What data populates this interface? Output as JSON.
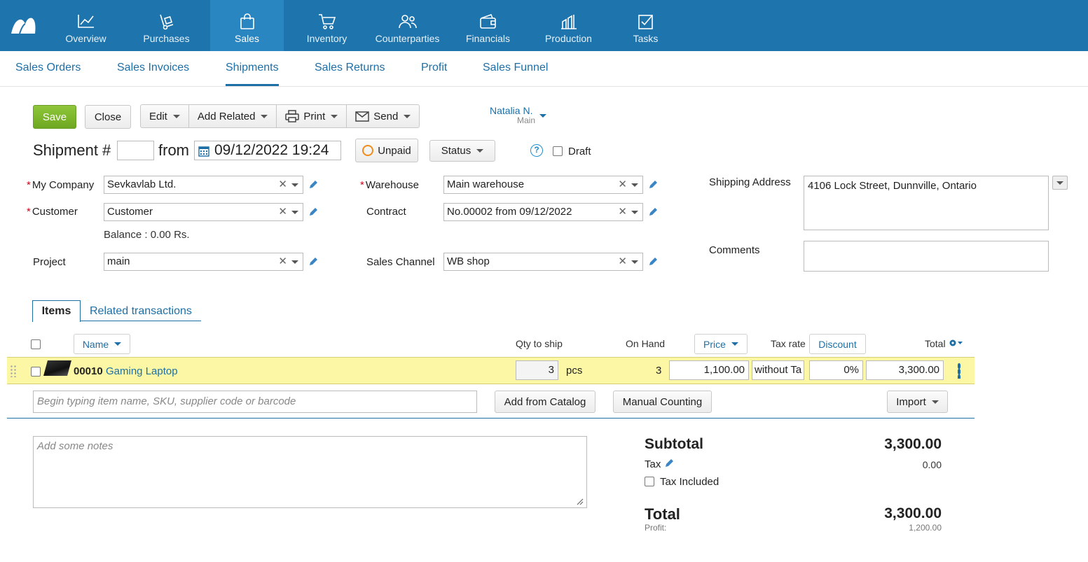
{
  "nav": {
    "items": [
      {
        "label": "Overview",
        "icon": "chart-line-icon"
      },
      {
        "label": "Purchases",
        "icon": "hand-truck-icon"
      },
      {
        "label": "Sales",
        "icon": "shopping-bag-icon"
      },
      {
        "label": "Inventory",
        "icon": "cart-icon"
      },
      {
        "label": "Counterparties",
        "icon": "people-icon"
      },
      {
        "label": "Financials",
        "icon": "wallet-icon"
      },
      {
        "label": "Production",
        "icon": "factory-icon"
      },
      {
        "label": "Tasks",
        "icon": "checkbox-icon"
      }
    ],
    "active": "Sales"
  },
  "subnav": {
    "items": [
      "Sales Orders",
      "Sales Invoices",
      "Shipments",
      "Sales Returns",
      "Profit",
      "Sales Funnel"
    ],
    "active": "Shipments"
  },
  "toolbar": {
    "save": "Save",
    "close": "Close",
    "edit": "Edit",
    "add_related": "Add Related",
    "print": "Print",
    "send": "Send",
    "user_name": "Natalia N.",
    "user_sub": "Main"
  },
  "doc": {
    "title": "Shipment #",
    "number": "",
    "from": "from",
    "date": "09/12/2022 19:24",
    "payment": "Unpaid",
    "status": "Status",
    "help": "?",
    "draft": "Draft"
  },
  "form": {
    "my_company_label": "My Company",
    "my_company": "Sevkavlab Ltd.",
    "customer_label": "Customer",
    "customer": "Customer",
    "balance": "Balance : 0.00 Rs.",
    "project_label": "Project",
    "project": "main",
    "warehouse_label": "Warehouse",
    "warehouse": "Main warehouse",
    "contract_label": "Contract",
    "contract": "No.00002 from 09/12/2022",
    "channel_label": "Sales Channel",
    "channel": "WB shop",
    "shipping_label": "Shipping Address",
    "shipping": "4106 Lock Street, Dunnville, Ontario",
    "comments_label": "Comments",
    "comments": ""
  },
  "tabs": {
    "items": "Items",
    "related": "Related transactions"
  },
  "table": {
    "columns": {
      "name": "Name",
      "qty": "Qty to ship",
      "on_hand": "On Hand",
      "price": "Price",
      "tax_rate": "Tax rate",
      "discount": "Discount",
      "total": "Total"
    },
    "rows": [
      {
        "code": "00010",
        "name": "Gaming Laptop",
        "qty": "3",
        "unit": "pcs",
        "on_hand": "3",
        "price": "1,100.00",
        "tax_rate": "without Ta",
        "discount": "0%",
        "total": "3,300.00"
      }
    ],
    "search_placeholder": "Begin typing item name, SKU, supplier code or barcode",
    "add_from_catalog": "Add from Catalog",
    "manual_counting": "Manual Counting",
    "import": "Import"
  },
  "notes_placeholder": "Add some notes",
  "summary": {
    "subtotal_label": "Subtotal",
    "subtotal": "3,300.00",
    "tax_label": "Tax",
    "tax": "0.00",
    "tax_included": "Tax Included",
    "total_label": "Total",
    "total": "3,300.00",
    "profit_label": "Profit:",
    "profit": "1,200.00"
  },
  "colors": {
    "nav_bg": "#1e74ac",
    "accent": "#1d6fa5",
    "save": "#7cb62b",
    "row_highlight": "#fbf7a4"
  }
}
